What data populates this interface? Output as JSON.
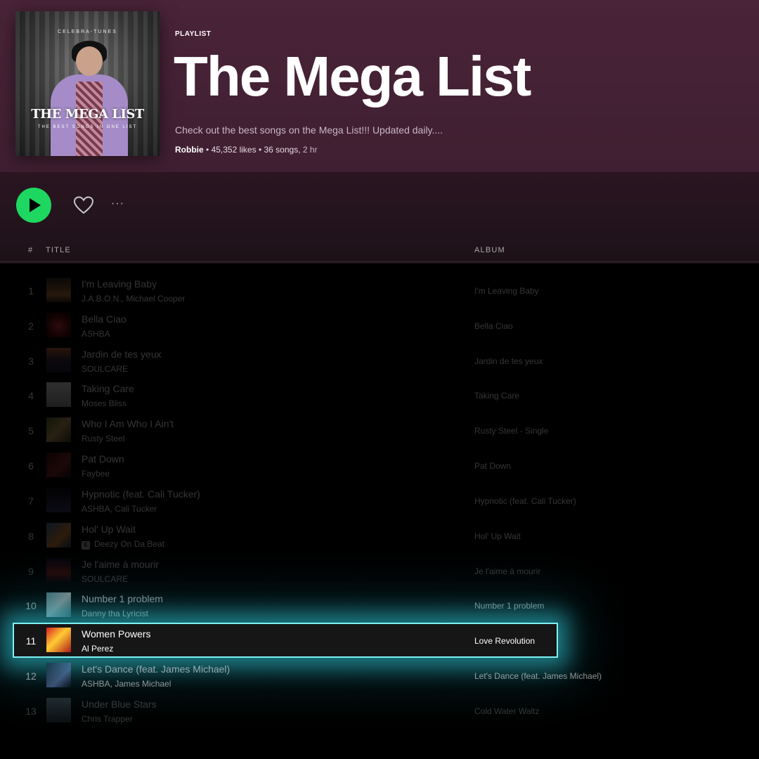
{
  "playlist": {
    "kind_label": "PLAYLIST",
    "title": "The Mega List",
    "description": "Check out the best songs on the Mega List!!! Updated daily....",
    "owner": "Robbie",
    "likes": "45,352 likes",
    "songs": "36 songs,",
    "duration": "2 hr",
    "cover": {
      "arc_text": "CELEBRA-TUNES",
      "title": "THE MEGA LIST",
      "subtitle": "THE BEST SONGS IN ONE LIST"
    }
  },
  "controls": {
    "play_icon": "play-icon",
    "like_icon": "heart-outline-icon",
    "more_label": "···",
    "accent_color": "#1ed760"
  },
  "columns": {
    "number": "#",
    "title": "TITLE",
    "album": "ALBUM"
  },
  "highlight_color": "#7ff0f5",
  "tracks": [
    {
      "num": "1",
      "name": "I'm Leaving Baby",
      "artist": "J.A.B.O.N., Michael Cooper",
      "album": "I'm Leaving Baby",
      "explicit": false
    },
    {
      "num": "2",
      "name": "Bella Ciao",
      "artist": "ASHBA",
      "album": "Bella Ciao",
      "explicit": false
    },
    {
      "num": "3",
      "name": "Jardin de tes yeux",
      "artist": "SOULCARE",
      "album": "Jardin de tes yeux",
      "explicit": false
    },
    {
      "num": "4",
      "name": "Taking Care",
      "artist": "Moses Bliss",
      "album": "Taking Care",
      "explicit": false
    },
    {
      "num": "5",
      "name": "Who I Am Who I Ain't",
      "artist": "Rusty Steel",
      "album": "Rusty Steel - Single",
      "explicit": false
    },
    {
      "num": "6",
      "name": "Pat Down",
      "artist": "Faybee",
      "album": "Pat Down",
      "explicit": false
    },
    {
      "num": "7",
      "name": "Hypnotic (feat. Cali Tucker)",
      "artist": "ASHBA, Cali Tucker",
      "album": "Hypnotic (feat. Cali Tucker)",
      "explicit": false
    },
    {
      "num": "8",
      "name": "Hol' Up Wait",
      "artist": "Deezy On Da Beat",
      "album": "Hol' Up Wait",
      "explicit": true,
      "explicit_label": "E"
    },
    {
      "num": "9",
      "name": "Je l'aime à mourir",
      "artist": "SOULCARE",
      "album": "Je l'aime à mourir",
      "explicit": false
    },
    {
      "num": "10",
      "name": "Number 1 problem",
      "artist": "Danny tha Lyricist",
      "album": "Number 1 problem",
      "explicit": false
    },
    {
      "num": "11",
      "name": "Women Powers",
      "artist": "Al Perez",
      "album": "Love Revolution",
      "explicit": false,
      "highlighted": true
    },
    {
      "num": "12",
      "name": "Let's Dance (feat. James Michael)",
      "artist": "ASHBA, James Michael",
      "album": "Let's Dance (feat. James Michael)",
      "explicit": false
    },
    {
      "num": "13",
      "name": "Under Blue Stars",
      "artist": "Chris Trapper",
      "album": "Cold Water Waltz",
      "explicit": false
    }
  ]
}
